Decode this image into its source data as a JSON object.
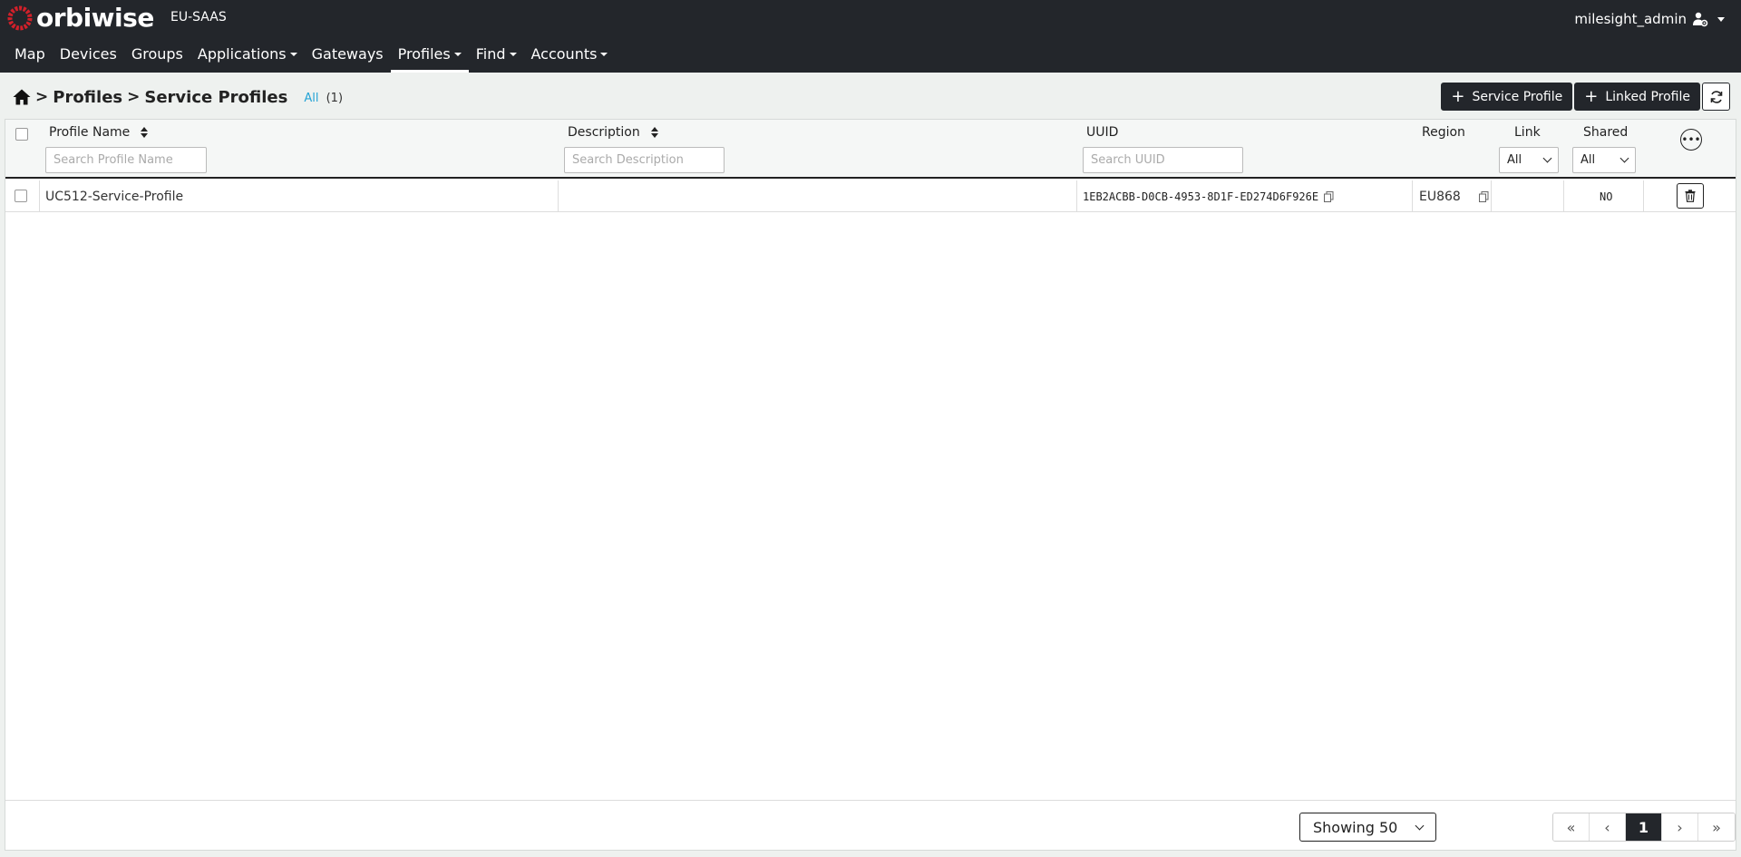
{
  "header": {
    "brand": "orbiwise",
    "environment": "EU-SAAS",
    "user": "milesight_admin",
    "user_icon": "user-gear-icon"
  },
  "nav": {
    "items": [
      {
        "label": "Map"
      },
      {
        "label": "Devices"
      },
      {
        "label": "Groups"
      },
      {
        "label": "Applications",
        "dropdown": true
      },
      {
        "label": "Gateways"
      },
      {
        "label": "Profiles",
        "dropdown": true,
        "active": true
      },
      {
        "label": "Find",
        "dropdown": true
      },
      {
        "label": "Accounts",
        "dropdown": true
      }
    ]
  },
  "breadcrumb": {
    "home_icon": "home-icon",
    "sep": ">",
    "items": [
      "Profiles",
      "Service Profiles"
    ]
  },
  "count": {
    "all_label": "All",
    "total": "(1)"
  },
  "actions": {
    "add_service_profile": "Service Profile",
    "add_linked_profile": "Linked Profile",
    "refresh_icon": "refresh-icon"
  },
  "table": {
    "columns": {
      "name": "Profile Name",
      "description": "Description",
      "uuid": "UUID",
      "region": "Region",
      "link": "Link",
      "shared": "Shared"
    },
    "filters": {
      "name_placeholder": "Search Profile Name",
      "description_placeholder": "Search Description",
      "uuid_placeholder": "Search UUID",
      "link_value": "All",
      "shared_value": "All"
    },
    "rows": [
      {
        "name": "UC512-Service-Profile",
        "description": "",
        "uuid": "1EB2ACBB-D0CB-4953-8D1F-ED274D6F926E",
        "region": "EU868",
        "link": "",
        "shared": "NO"
      }
    ]
  },
  "footer": {
    "page_size": "Showing 50",
    "pager": {
      "first": "«",
      "prev": "‹",
      "current": "1",
      "next": "›",
      "last": "»"
    }
  },
  "colors": {
    "header_bg": "#23262b",
    "accent": "#24a3d6",
    "logo_red": "#d3202a"
  }
}
